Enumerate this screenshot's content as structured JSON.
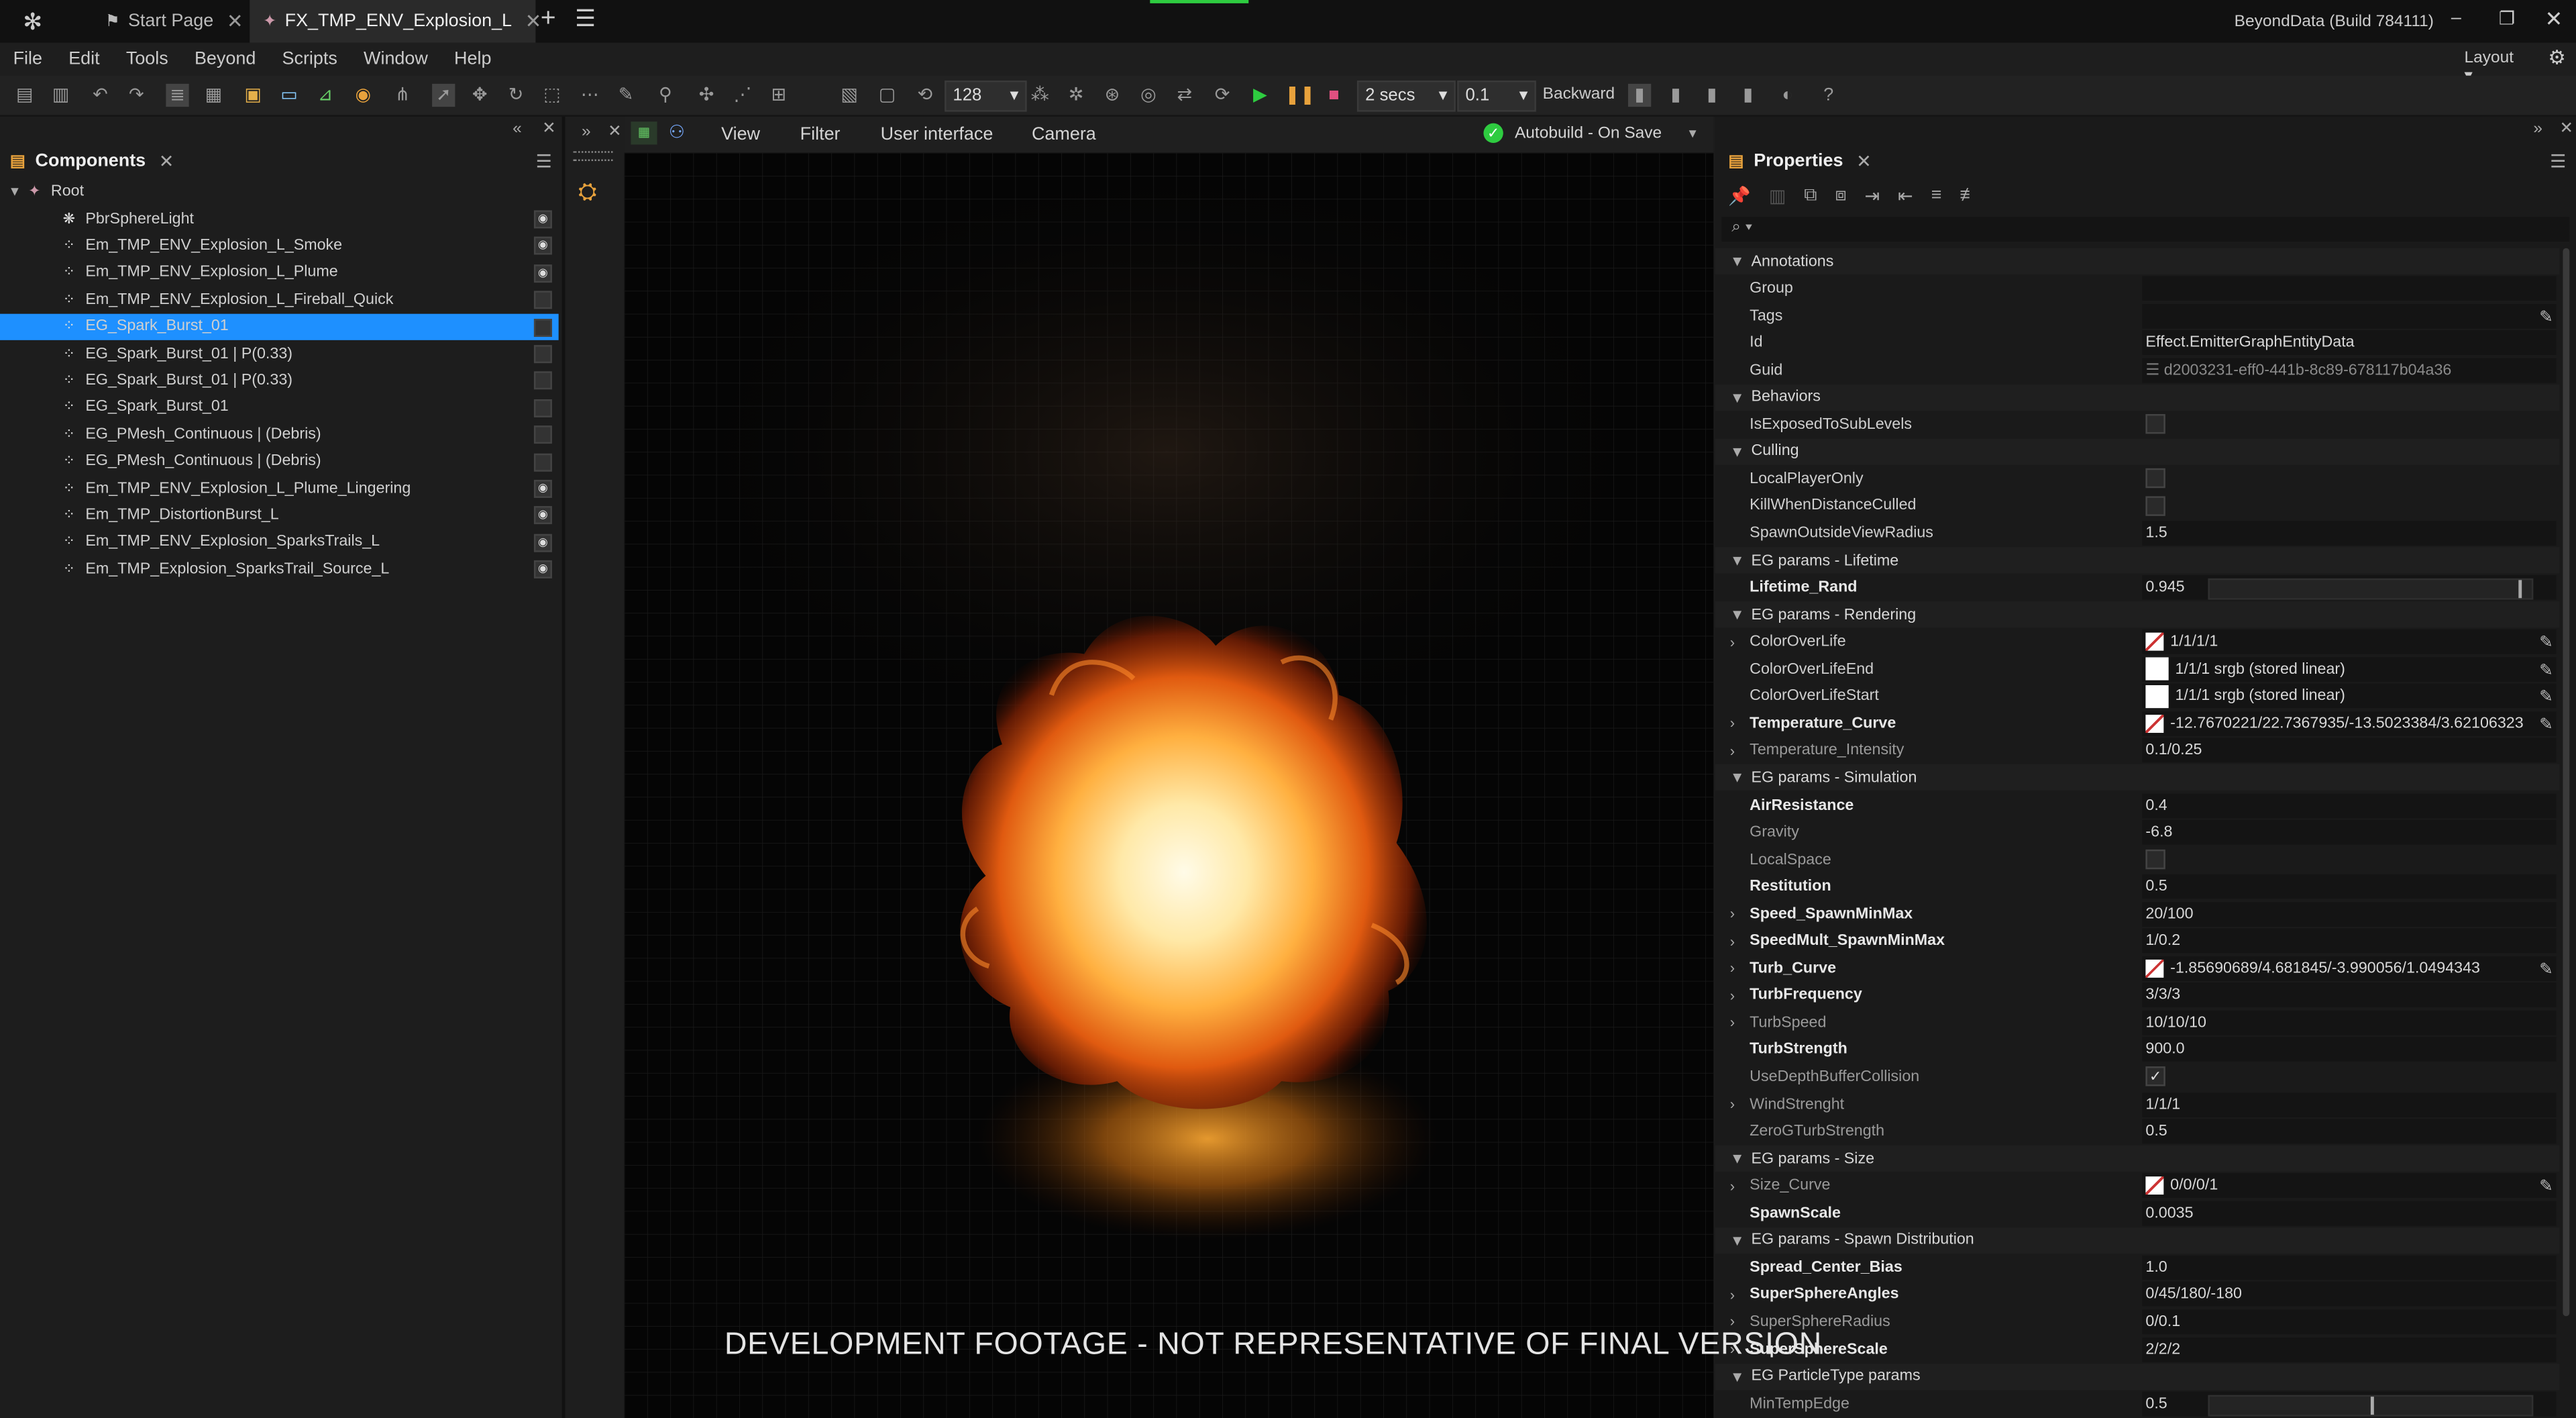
{
  "titlebar": {
    "tabs": [
      {
        "label": "Start Page"
      },
      {
        "label": "FX_TMP_ENV_Explosion_L"
      }
    ],
    "build": "BeyondData (Build 784111)"
  },
  "menu": [
    "File",
    "Edit",
    "Tools",
    "Beyond",
    "Scripts",
    "Window",
    "Help"
  ],
  "layout_label": "Layout",
  "toolbar": {
    "resolution": "128",
    "duration": "2 secs",
    "step": "0.1",
    "direction": "Backward"
  },
  "components": {
    "title": "Components",
    "root": "Root",
    "items": [
      {
        "label": "PbrSphereLight",
        "visible": true,
        "selected": false
      },
      {
        "label": "Em_TMP_ENV_Explosion_L_Smoke",
        "visible": true,
        "selected": false
      },
      {
        "label": "Em_TMP_ENV_Explosion_L_Plume",
        "visible": true,
        "selected": false
      },
      {
        "label": "Em_TMP_ENV_Explosion_L_Fireball_Quick",
        "visible": false,
        "selected": false
      },
      {
        "label": "EG_Spark_Burst_01",
        "visible": false,
        "selected": true
      },
      {
        "label": "EG_Spark_Burst_01 | P(0.33)",
        "visible": false,
        "selected": false
      },
      {
        "label": "EG_Spark_Burst_01 | P(0.33)",
        "visible": false,
        "selected": false
      },
      {
        "label": "EG_Spark_Burst_01",
        "visible": false,
        "selected": false
      },
      {
        "label": "EG_PMesh_Continuous | (Debris)",
        "visible": false,
        "selected": false
      },
      {
        "label": "EG_PMesh_Continuous | (Debris)",
        "visible": false,
        "selected": false
      },
      {
        "label": "Em_TMP_ENV_Explosion_L_Plume_Lingering",
        "visible": true,
        "selected": false
      },
      {
        "label": "Em_TMP_DistortionBurst_L",
        "visible": true,
        "selected": false
      },
      {
        "label": "Em_TMP_ENV_Explosion_SparksTrails_L",
        "visible": true,
        "selected": false
      },
      {
        "label": "Em_TMP_Explosion_SparksTrail_Source_L",
        "visible": true,
        "selected": false
      }
    ]
  },
  "viewport": {
    "menu": [
      "View",
      "Filter",
      "User interface",
      "Camera"
    ],
    "autobuild": "Autobuild - On Save",
    "footage_text": "DEVELOPMENT FOOTAGE - NOT REPRESENTATIVE OF FINAL VERSION"
  },
  "properties": {
    "title": "Properties",
    "rows": [
      {
        "kind": "section",
        "label": "Annotations"
      },
      {
        "kind": "prop",
        "name": "Group",
        "value": ""
      },
      {
        "kind": "prop",
        "name": "Tags",
        "value": "",
        "edit": true
      },
      {
        "kind": "prop",
        "name": "Id",
        "value": "Effect.EmitterGraphEntityData"
      },
      {
        "kind": "prop",
        "name": "Guid",
        "value": "d2003231-eff0-441b-8c89-678117b04a36",
        "dim_value": true
      },
      {
        "kind": "section",
        "label": "Behaviors"
      },
      {
        "kind": "prop",
        "name": "IsExposedToSubLevels",
        "check": false
      },
      {
        "kind": "section",
        "label": "Culling"
      },
      {
        "kind": "prop",
        "name": "LocalPlayerOnly",
        "check": false
      },
      {
        "kind": "prop",
        "name": "KillWhenDistanceCulled",
        "check": false
      },
      {
        "kind": "prop",
        "name": "SpawnOutsideViewRadius",
        "value": "1.5"
      },
      {
        "kind": "section",
        "label": "EG params - Lifetime"
      },
      {
        "kind": "prop",
        "name": "Lifetime_Rand",
        "value": "0.945",
        "bold": true,
        "slider": 0.96
      },
      {
        "kind": "section",
        "label": "EG params - Rendering"
      },
      {
        "kind": "prop",
        "name": "ColorOverLife",
        "value": "1/1/1/1",
        "expand": true,
        "swatch": "curve",
        "edit": true
      },
      {
        "kind": "prop",
        "name": "ColorOverLifeEnd",
        "value": "1/1/1 srgb (stored linear)",
        "swatch": "white",
        "edit": true
      },
      {
        "kind": "prop",
        "name": "ColorOverLifeStart",
        "value": "1/1/1 srgb (stored linear)",
        "swatch": "white",
        "edit": true
      },
      {
        "kind": "prop",
        "name": "Temperature_Curve",
        "value": "-12.7670221/22.7367935/-13.5023384/3.62106323",
        "bold": true,
        "expand": true,
        "swatch": "curve",
        "edit": true
      },
      {
        "kind": "prop",
        "name": "Temperature_Intensity",
        "value": "0.1/0.25",
        "dim": true,
        "expand": true
      },
      {
        "kind": "section",
        "label": "EG params - Simulation"
      },
      {
        "kind": "prop",
        "name": "AirResistance",
        "value": "0.4",
        "bold": true
      },
      {
        "kind": "prop",
        "name": "Gravity",
        "value": "-6.8",
        "dim": true
      },
      {
        "kind": "prop",
        "name": "LocalSpace",
        "check": false,
        "dim": true
      },
      {
        "kind": "prop",
        "name": "Restitution",
        "value": "0.5",
        "bold": true
      },
      {
        "kind": "prop",
        "name": "Speed_SpawnMinMax",
        "value": "20/100",
        "bold": true,
        "expand": true
      },
      {
        "kind": "prop",
        "name": "SpeedMult_SpawnMinMax",
        "value": "1/0.2",
        "bold": true,
        "expand": true
      },
      {
        "kind": "prop",
        "name": "Turb_Curve",
        "value": "-1.85690689/4.681845/-3.990056/1.0494343",
        "bold": true,
        "expand": true,
        "swatch": "curve",
        "edit": true
      },
      {
        "kind": "prop",
        "name": "TurbFrequency",
        "value": "3/3/3",
        "bold": true,
        "expand": true
      },
      {
        "kind": "prop",
        "name": "TurbSpeed",
        "value": "10/10/10",
        "dim": true,
        "expand": true
      },
      {
        "kind": "prop",
        "name": "TurbStrength",
        "value": "900.0",
        "bold": true
      },
      {
        "kind": "prop",
        "name": "UseDepthBufferCollision",
        "check": true,
        "dim": true
      },
      {
        "kind": "prop",
        "name": "WindStrenght",
        "value": "1/1/1",
        "dim": true,
        "expand": true
      },
      {
        "kind": "prop",
        "name": "ZeroGTurbStrength",
        "value": "0.5",
        "dim": true
      },
      {
        "kind": "section",
        "label": "EG params - Size"
      },
      {
        "kind": "prop",
        "name": "Size_Curve",
        "value": "0/0/0/1",
        "dim": true,
        "expand": true,
        "swatch": "curve",
        "edit": true
      },
      {
        "kind": "prop",
        "name": "SpawnScale",
        "value": "0.0035",
        "bold": true
      },
      {
        "kind": "section",
        "label": "EG params - Spawn Distribution"
      },
      {
        "kind": "prop",
        "name": "Spread_Center_Bias",
        "value": "1.0",
        "bold": true
      },
      {
        "kind": "prop",
        "name": "SuperSphereAngles",
        "value": "0/45/180/-180",
        "bold": true,
        "expand": true
      },
      {
        "kind": "prop",
        "name": "SuperSphereRadius",
        "value": "0/0.1",
        "dim": true,
        "expand": true
      },
      {
        "kind": "prop",
        "name": "SuperSphereScale",
        "value": "2/2/2",
        "bold": true,
        "expand": true
      },
      {
        "kind": "section",
        "label": "EG ParticleType params"
      },
      {
        "kind": "prop",
        "name": "MinTempEdge",
        "value": "0.5",
        "dim": true,
        "slider": 0.5
      }
    ]
  },
  "colors": {
    "selection": "#1e90ff",
    "play": "#2ecc40",
    "pause": "#e8a23c",
    "stop": "#e05080",
    "autobuild_ok": "#2ecc40"
  }
}
